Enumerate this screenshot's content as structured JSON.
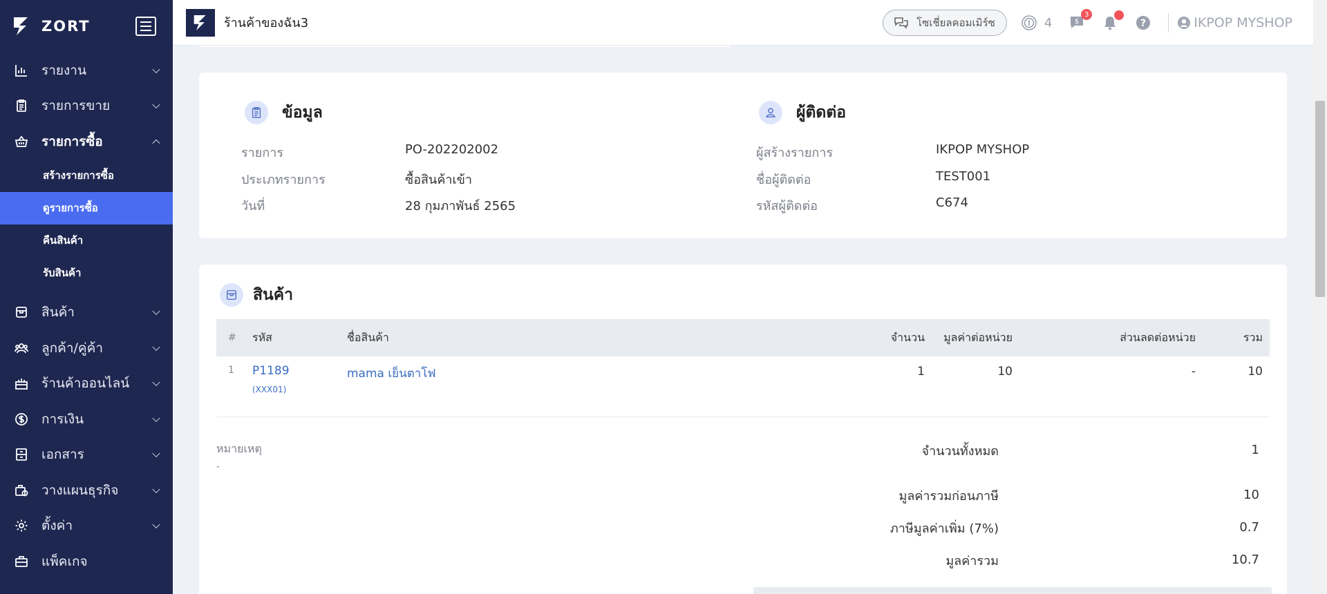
{
  "brand": {
    "name": "ZORT"
  },
  "sidebar": {
    "items": [
      {
        "label": "รายงาน",
        "icon": "bar-chart-icon"
      },
      {
        "label": "รายการขาย",
        "icon": "clipboard-icon"
      },
      {
        "label": "รายการซื้อ",
        "icon": "basket-icon",
        "expanded": true
      },
      {
        "label": "สินค้า",
        "icon": "box-icon"
      },
      {
        "label": "ลูกค้า/คู่ค้า",
        "icon": "users-icon"
      },
      {
        "label": "ร้านค้าออนไลน์",
        "icon": "gift-icon"
      },
      {
        "label": "การเงิน",
        "icon": "dollar-circle-icon"
      },
      {
        "label": "เอกสาร",
        "icon": "archive-icon"
      },
      {
        "label": "วางแผนธุรกิจ",
        "icon": "briefcase-chart-icon"
      },
      {
        "label": "ตั้งค่า",
        "icon": "gear-icon"
      },
      {
        "label": "แพ็คเกจ",
        "icon": "briefcase-icon"
      }
    ],
    "purchase_sub": [
      {
        "label": "สร้างรายการซื้อ"
      },
      {
        "label": "ดูรายการซื้อ",
        "active": true
      },
      {
        "label": "คืนสินค้า"
      },
      {
        "label": "รับสินค้า"
      }
    ]
  },
  "header": {
    "store_name": "ร้านค้าของฉัน3",
    "social_label": "โซเชี่ยลคอมเมิร์ซ",
    "coin_count": "4",
    "chat_badge": "3",
    "user_name": "IKPOP MYSHOP"
  },
  "info": {
    "title": "ข้อมูล",
    "rows": [
      {
        "label": "รายการ",
        "value": "PO-202202002"
      },
      {
        "label": "ประเภทรายการ",
        "value": "ซื้อสินค้าเข้า"
      },
      {
        "label": "วันที่",
        "value": "28 กุมภาพันธ์ 2565"
      }
    ]
  },
  "contact": {
    "title": "ผู้ติดต่อ",
    "rows": [
      {
        "label": "ผู้สร้างรายการ",
        "value": "IKPOP MYSHOP"
      },
      {
        "label": "ชื่อผู้ติดต่อ",
        "value": "TEST001"
      },
      {
        "label": "รหัสผู้ติดต่อ",
        "value": "C674"
      }
    ]
  },
  "products": {
    "title": "สินค้า",
    "columns": {
      "index": "#",
      "code": "รหัส",
      "name": "ชื่อสินค้า",
      "qty": "จำนวน",
      "unit_price": "มูลค่าต่อหน่วย",
      "discount": "ส่วนลดต่อหน่วย",
      "total": "รวม"
    },
    "rows": [
      {
        "index": "1",
        "code": "P1189",
        "sub_code": "(XXX01)",
        "name": "mama เย็นตาโฟ",
        "qty": "1",
        "unit_price": "10",
        "discount": "-",
        "total": "10"
      }
    ],
    "remark_label": "หมายเหตุ",
    "remark_value": "-"
  },
  "summary": {
    "total_qty_label": "จำนวนทั้งหมด",
    "total_qty": "1",
    "pre_tax_label": "มูลค่ารวมก่อนภาษี",
    "pre_tax": "10",
    "vat_label": "ภาษีมูลค่าเพิ่ม (7%)",
    "vat": "0.7",
    "grand_label": "มูลค่ารวม",
    "grand": "10.7"
  },
  "colors": {
    "sidebar": "#1e2750",
    "active": "#4a6cf0",
    "link": "#3b6cc0",
    "badge": "#f2545b"
  }
}
